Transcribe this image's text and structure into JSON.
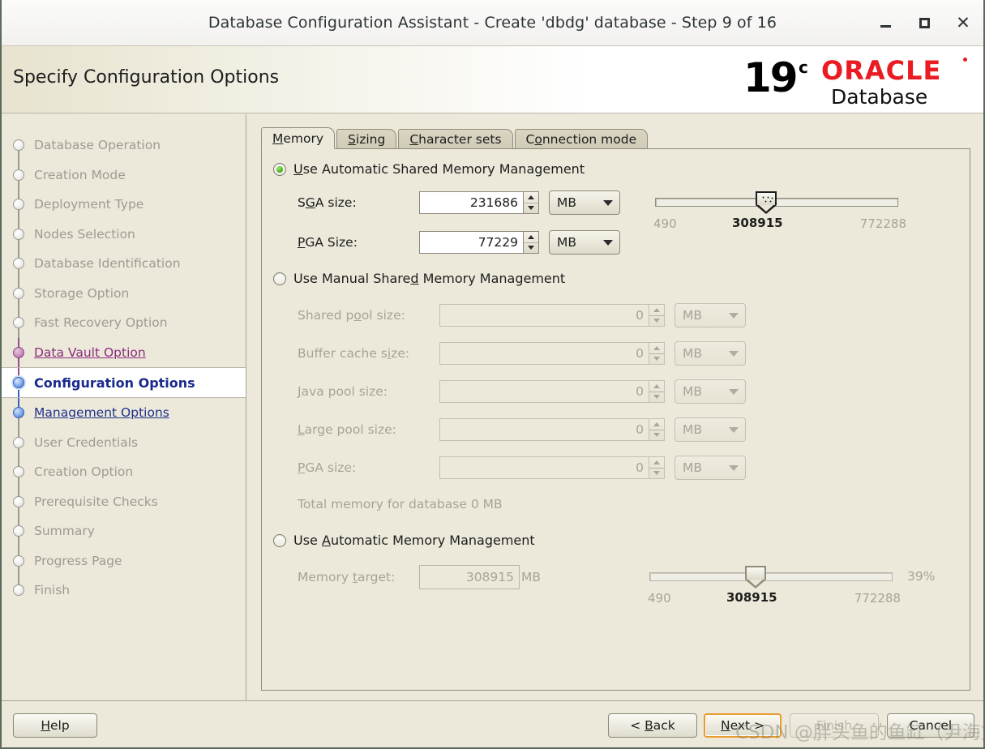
{
  "window": {
    "title": "Database Configuration Assistant - Create 'dbdg' database - Step 9 of 16",
    "minimize_icon": "minimize-icon",
    "maximize_icon": "maximize-icon",
    "close_icon": "close-icon"
  },
  "header": {
    "title": "Specify Configuration Options",
    "logo": {
      "version": "19",
      "suffix": "c",
      "brand": "ORACLE",
      "product": "Database"
    }
  },
  "sidebar": {
    "items": [
      {
        "label": "Database Operation",
        "state": "pending"
      },
      {
        "label": "Creation Mode",
        "state": "pending"
      },
      {
        "label": "Deployment Type",
        "state": "pending"
      },
      {
        "label": "Nodes Selection",
        "state": "pending"
      },
      {
        "label": "Database Identification",
        "state": "pending"
      },
      {
        "label": "Storage Option",
        "state": "pending"
      },
      {
        "label": "Fast Recovery Option",
        "state": "pending"
      },
      {
        "label": "Data Vault Option",
        "state": "done"
      },
      {
        "label": "Configuration Options",
        "state": "current"
      },
      {
        "label": "Management Options",
        "state": "next"
      },
      {
        "label": "User Credentials",
        "state": "pending"
      },
      {
        "label": "Creation Option",
        "state": "pending"
      },
      {
        "label": "Prerequisite Checks",
        "state": "pending"
      },
      {
        "label": "Summary",
        "state": "pending"
      },
      {
        "label": "Progress Page",
        "state": "pending"
      },
      {
        "label": "Finish",
        "state": "pending"
      }
    ]
  },
  "tabs": [
    {
      "label": "Memory",
      "mnemonic": "M",
      "active": true
    },
    {
      "label": "Sizing",
      "mnemonic": "S",
      "active": false
    },
    {
      "label": "Character sets",
      "mnemonic": "C",
      "active": false
    },
    {
      "label": "Connection mode",
      "mnemonic": "o",
      "active": false
    }
  ],
  "memory": {
    "automatic_shared": {
      "label_pre": "U",
      "label_mnemonic": "U",
      "label": "Use Automatic Shared Memory Management",
      "selected": true,
      "sga": {
        "label": "SGA size:",
        "value": "231686",
        "unit": "MB"
      },
      "pga": {
        "label": "PGA Size:",
        "value": "77229",
        "unit": "MB"
      },
      "slider": {
        "min_label": "490",
        "value_label": "308915",
        "max_label": "772288",
        "min": 490,
        "value": 308915,
        "max": 772288
      }
    },
    "manual_shared": {
      "label": "Use Manual Shared Memory Management",
      "selected": false,
      "fields": [
        {
          "label": "Shared pool size:",
          "value": "0",
          "unit": "MB"
        },
        {
          "label": "Buffer cache size:",
          "value": "0",
          "unit": "MB"
        },
        {
          "label": "Java pool size:",
          "value": "0",
          "unit": "MB"
        },
        {
          "label": "Large pool size:",
          "value": "0",
          "unit": "MB"
        },
        {
          "label": "PGA size:",
          "value": "0",
          "unit": "MB"
        }
      ],
      "total_memory": "Total memory for database 0 MB"
    },
    "automatic_memory": {
      "label": "Use Automatic Memory Management",
      "selected": false,
      "memory_target": {
        "label": "Memory target:",
        "value": "308915",
        "unit": "MB"
      },
      "slider": {
        "min_label": "490",
        "value_label": "308915",
        "max_label": "772288",
        "min": 490,
        "value": 308915,
        "max": 772288,
        "percent_label": "39%"
      }
    }
  },
  "footer": {
    "help": "Help",
    "back": "< Back",
    "next": "Next >",
    "finish": "Finish",
    "cancel": "Cancel"
  },
  "watermark": "CSDN @胖头鱼的鱼缸（尹海文）",
  "colors": {
    "background": "#ece9da",
    "accent_focus": "#e89a2c",
    "oracle_red": "#ea1b22",
    "current_step": "#1a2a8c",
    "done_step": "#8a2d7d",
    "radio_on": "#3faa1f"
  }
}
